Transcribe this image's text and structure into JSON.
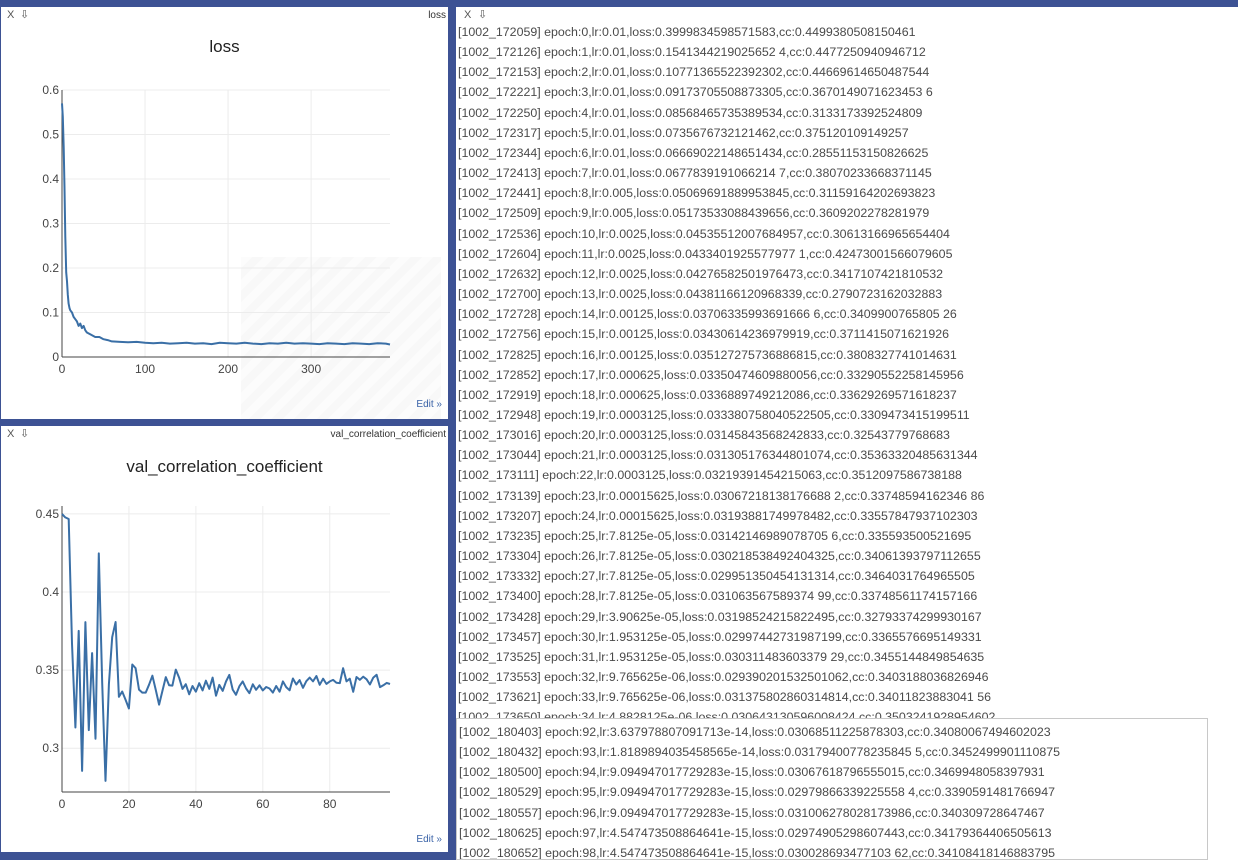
{
  "loss_pane": {
    "close_label": "X",
    "pin_label": "⇩",
    "tag": "loss",
    "edit_label": "Edit »"
  },
  "cc_pane": {
    "close_label": "X",
    "pin_label": "⇩",
    "tag": "val_correlation_coefficient",
    "edit_label": "Edit »"
  },
  "log_pane": {
    "close_label": "X",
    "pin_label": "⇩",
    "lines": [
      "[1002_172059] epoch:0,lr:0.01,loss:0.3999834598571583,cc:0.4499380508150461",
      "[1002_172126] epoch:1,lr:0.01,loss:0.1541344219025652 4,cc:0.4477250940946712",
      "[1002_172153] epoch:2,lr:0.01,loss:0.10771365522392302,cc:0.44669614650487544",
      "[1002_172221] epoch:3,lr:0.01,loss:0.09173705508873305,cc:0.3670149071623453 6",
      "[1002_172250] epoch:4,lr:0.01,loss:0.08568465735389534,cc:0.3133173392524809",
      "[1002_172317] epoch:5,lr:0.01,loss:0.0735676732121462,cc:0.375120109149257",
      "[1002_172344] epoch:6,lr:0.01,loss:0.06669022148651434,cc:0.28551153150826625",
      "[1002_172413] epoch:7,lr:0.01,loss:0.0677839191066214 7,cc:0.38070233668371145",
      "[1002_172441] epoch:8,lr:0.005,loss:0.05069691889953845,cc:0.31159164202693823",
      "[1002_172509] epoch:9,lr:0.005,loss:0.05173533088439656,cc:0.3609202278281979",
      "[1002_172536] epoch:10,lr:0.0025,loss:0.04535512007684957,cc:0.30613166965654404",
      "[1002_172604] epoch:11,lr:0.0025,loss:0.0433401925577977 1,cc:0.42473001566079605",
      "[1002_172632] epoch:12,lr:0.0025,loss:0.04276582501976473,cc:0.3417107421810532",
      "[1002_172700] epoch:13,lr:0.0025,loss:0.04381166120968339,cc:0.2790723162032883",
      "[1002_172728] epoch:14,lr:0.00125,loss:0.03706335993691666 6,cc:0.3409900765805 26",
      "[1002_172756] epoch:15,lr:0.00125,loss:0.03430614236979919,cc:0.3711415071621926",
      "[1002_172825] epoch:16,lr:0.00125,loss:0.035127275736886815,cc:0.3808327741014631",
      "[1002_172852] epoch:17,lr:0.000625,loss:0.03350474609880056,cc:0.33290552258145956",
      "[1002_172919] epoch:18,lr:0.000625,loss:0.0336889749212086,cc:0.33629269571618237",
      "[1002_172948] epoch:19,lr:0.0003125,loss:0.033380758040522505,cc:0.3309473415199511",
      "[1002_173016] epoch:20,lr:0.0003125,loss:0.03145843568242833,cc:0.32543779768683",
      "[1002_173044] epoch:21,lr:0.0003125,loss:0.031305176344801074,cc:0.35363320485631344",
      "[1002_173111] epoch:22,lr:0.0003125,loss:0.03219391454215063,cc:0.3512097586738188",
      "[1002_173139] epoch:23,lr:0.00015625,loss:0.03067218138176688 2,cc:0.33748594162346 86",
      "[1002_173207] epoch:24,lr:0.00015625,loss:0.03193881749978482,cc:0.33557847937102303",
      "[1002_173235] epoch:25,lr:7.8125e-05,loss:0.03142146989078705 6,cc:0.335593500521695",
      "[1002_173304] epoch:26,lr:7.8125e-05,loss:0.030218538492404325,cc:0.34061393797112655",
      "[1002_173332] epoch:27,lr:7.8125e-05,loss:0.029951350454131314,cc:0.3464031764965505",
      "[1002_173400] epoch:28,lr:7.8125e-05,loss:0.031063567589374 99,cc:0.33748561174157166",
      "[1002_173428] epoch:29,lr:3.90625e-05,loss:0.03198524215822495,cc:0.32793374299930167",
      "[1002_173457] epoch:30,lr:1.953125e-05,loss:0.02997442731987199,cc:0.3365576695149331",
      "[1002_173525] epoch:31,lr:1.953125e-05,loss:0.030311483603379 29,cc:0.3455144849854635",
      "[1002_173553] epoch:32,lr:9.765625e-06,loss:0.029390201532501062,cc:0.3403188036826946",
      "[1002_173621] epoch:33,lr:9.765625e-06,loss:0.031375802860314814,cc:0.34011823883041 56",
      "[1002_173650] epoch:34,lr:4.8828125e-06,loss:0.030643130596008424,cc:0.3503241928954602"
    ]
  },
  "log_overlay": {
    "lines": [
      "[1002_180403] epoch:92,lr:3.637978807091713e-14,loss:0.03068511225878303,cc:0.34080067494602023",
      "[1002_180432] epoch:93,lr:1.8189894035458565e-14,loss:0.03179400778235845 5,cc:0.3452499901110875",
      "[1002_180500] epoch:94,lr:9.094947017729283e-15,loss:0.03067618796555015,cc:0.3469948058397931",
      "[1002_180529] epoch:95,lr:9.094947017729283e-15,loss:0.02979866339225558 4,cc:0.3390591481766947",
      "[1002_180557] epoch:96,lr:9.094947017729283e-15,loss:0.031006278028173986,cc:0.340309728647467",
      "[1002_180625] epoch:97,lr:4.547473508864641e-15,loss:0.02974905298607443,cc:0.34179364406505613",
      "[1002_180652] epoch:98,lr:4.547473508864641e-15,loss:0.030028693477103 62,cc:0.34108418146883795"
    ]
  },
  "chart_data": [
    {
      "type": "line",
      "title": "loss",
      "xlabel": "",
      "ylabel": "",
      "xlim": [
        0,
        395
      ],
      "ylim": [
        0,
        0.6
      ],
      "xticks": [
        0,
        100,
        200,
        300
      ],
      "yticks": [
        0,
        0.1,
        0.2,
        0.3,
        0.4,
        0.5,
        0.6
      ],
      "tick_labels_y": [
        "0",
        "0.1",
        "0.2",
        "0.3",
        "0.4",
        "0.5",
        "0.6"
      ],
      "tick_labels_x": [
        "0",
        "100",
        "200",
        "300"
      ],
      "grid": true,
      "series": [
        {
          "color": "#3a6fa6",
          "x": [
            0,
            1,
            2,
            3,
            4,
            5,
            6,
            7,
            8,
            9,
            10,
            12,
            14,
            16,
            18,
            20,
            22,
            24,
            26,
            28,
            30,
            35,
            40,
            45,
            50,
            55,
            60,
            70,
            80,
            90,
            100,
            110,
            120,
            130,
            140,
            150,
            160,
            170,
            180,
            190,
            200,
            210,
            220,
            230,
            240,
            250,
            260,
            270,
            280,
            290,
            300,
            310,
            320,
            330,
            340,
            350,
            360,
            370,
            380,
            390,
            395
          ],
          "y": [
            0.57,
            0.54,
            0.47,
            0.38,
            0.27,
            0.19,
            0.17,
            0.14,
            0.12,
            0.11,
            0.105,
            0.1,
            0.09,
            0.085,
            0.08,
            0.07,
            0.075,
            0.065,
            0.07,
            0.06,
            0.055,
            0.05,
            0.045,
            0.045,
            0.04,
            0.038,
            0.035,
            0.034,
            0.033,
            0.034,
            0.032,
            0.031,
            0.032,
            0.03,
            0.031,
            0.032,
            0.03,
            0.031,
            0.029,
            0.032,
            0.031,
            0.03,
            0.032,
            0.03,
            0.029,
            0.031,
            0.03,
            0.032,
            0.03,
            0.031,
            0.03,
            0.029,
            0.031,
            0.03,
            0.029,
            0.031,
            0.03,
            0.029,
            0.031,
            0.03,
            0.028
          ]
        }
      ]
    },
    {
      "type": "line",
      "title": "val_correlation_coefficient",
      "xlabel": "",
      "ylabel": "",
      "xlim": [
        0,
        98
      ],
      "ylim": [
        0.272,
        0.455
      ],
      "xticks": [
        0,
        20,
        40,
        60,
        80
      ],
      "yticks": [
        0.3,
        0.35,
        0.4,
        0.45
      ],
      "tick_labels_y": [
        "0.3",
        "0.35",
        "0.4",
        "0.45"
      ],
      "tick_labels_x": [
        "0",
        "20",
        "40",
        "60",
        "80"
      ],
      "grid": true,
      "series": [
        {
          "color": "#3a6fa6",
          "x": [
            0,
            1,
            2,
            3,
            4,
            5,
            6,
            7,
            8,
            9,
            10,
            11,
            12,
            13,
            14,
            15,
            16,
            17,
            18,
            19,
            20,
            21,
            22,
            23,
            24,
            25,
            26,
            27,
            28,
            29,
            30,
            31,
            32,
            33,
            34,
            35,
            36,
            37,
            38,
            39,
            40,
            41,
            42,
            43,
            44,
            45,
            46,
            47,
            48,
            49,
            50,
            51,
            52,
            53,
            54,
            55,
            56,
            57,
            58,
            59,
            60,
            61,
            62,
            63,
            64,
            65,
            66,
            67,
            68,
            69,
            70,
            71,
            72,
            73,
            74,
            75,
            76,
            77,
            78,
            79,
            80,
            81,
            82,
            83,
            84,
            85,
            86,
            87,
            88,
            89,
            90,
            91,
            92,
            93,
            94,
            95,
            96,
            97,
            98
          ],
          "y": [
            0.4499,
            0.4477,
            0.4467,
            0.367,
            0.3133,
            0.3751,
            0.2855,
            0.3807,
            0.3116,
            0.3609,
            0.3061,
            0.4247,
            0.3417,
            0.2791,
            0.341,
            0.3711,
            0.3808,
            0.3329,
            0.3363,
            0.3309,
            0.3254,
            0.3536,
            0.3512,
            0.3375,
            0.3356,
            0.3356,
            0.3406,
            0.3464,
            0.3375,
            0.3279,
            0.3366,
            0.3455,
            0.3403,
            0.3401,
            0.3503,
            0.3452,
            0.338,
            0.341,
            0.3345,
            0.3398,
            0.3362,
            0.3416,
            0.337,
            0.3432,
            0.338,
            0.3452,
            0.3336,
            0.3405,
            0.3367,
            0.3427,
            0.3469,
            0.3375,
            0.3342,
            0.3397,
            0.3428,
            0.3382,
            0.3352,
            0.3409,
            0.3374,
            0.3403,
            0.337,
            0.3392,
            0.3382,
            0.3356,
            0.3398,
            0.3362,
            0.3428,
            0.3391,
            0.3371,
            0.3446,
            0.3408,
            0.3436,
            0.3387,
            0.3429,
            0.3452,
            0.3428,
            0.3462,
            0.3406,
            0.3445,
            0.3412,
            0.3428,
            0.3437,
            0.3419,
            0.3417,
            0.3512,
            0.3428,
            0.3445,
            0.3361,
            0.3456,
            0.3438,
            0.3458,
            0.3441,
            0.3408,
            0.3452,
            0.347,
            0.3391,
            0.3403,
            0.3418,
            0.3411
          ]
        }
      ]
    }
  ]
}
